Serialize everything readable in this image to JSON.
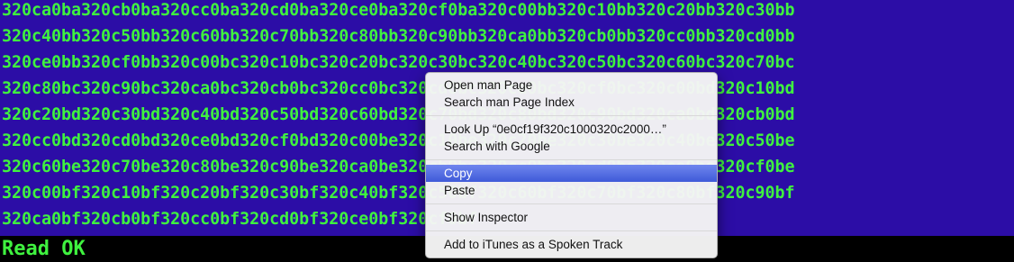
{
  "terminal": {
    "lines": [
      "320ca0ba320cb0ba320cc0ba320cd0ba320ce0ba320cf0ba320c00bb320c10bb320c20bb320c30bb",
      "320c40bb320c50bb320c60bb320c70bb320c80bb320c90bb320ca0bb320cb0bb320cc0bb320cd0bb",
      "320ce0bb320cf0bb320c00bc320c10bc320c20bc320c30bc320c40bc320c50bc320c60bc320c70bc",
      "320c80bc320c90bc320ca0bc320cb0bc320cc0bc320cd0bc320ce0bc320cf0bc320c00bd320c10bd",
      "320c20bd320c30bd320c40bd320c50bd320c60bd320c70bd320c80bd320c90bd320ca0bd320cb0bd",
      "320cc0bd320cd0bd320ce0bd320cf0bd320c00be320c10be320c20be320c30be320c40be320c50be",
      "320c60be320c70be320c80be320c90be320ca0be320cb0be320cc0be320cd0be320ce0be320cf0be",
      "320c00bf320c10bf320c20bf320c30bf320c40bf320c50bf320c60bf320c70bf320c80bf320c90bf",
      "320ca0bf320cb0bf320cc0bf320cd0bf320ce0bf320cf0bf"
    ],
    "status": "Read OK",
    "colors": {
      "text": "#3ff23f",
      "selection": "#2c0da6",
      "background": "#000000"
    }
  },
  "context_menu": {
    "items": [
      {
        "label": "Open man Page"
      },
      {
        "label": "Search man Page Index"
      },
      {
        "label": "Look Up “0e0cf19f320c1000320c2000…”"
      },
      {
        "label": "Search with Google"
      },
      {
        "label": "Copy",
        "highlighted": true
      },
      {
        "label": "Paste"
      },
      {
        "label": "Show Inspector"
      },
      {
        "label": "Add to iTunes as a Spoken Track"
      }
    ],
    "highlight_color": "#4a65de"
  }
}
